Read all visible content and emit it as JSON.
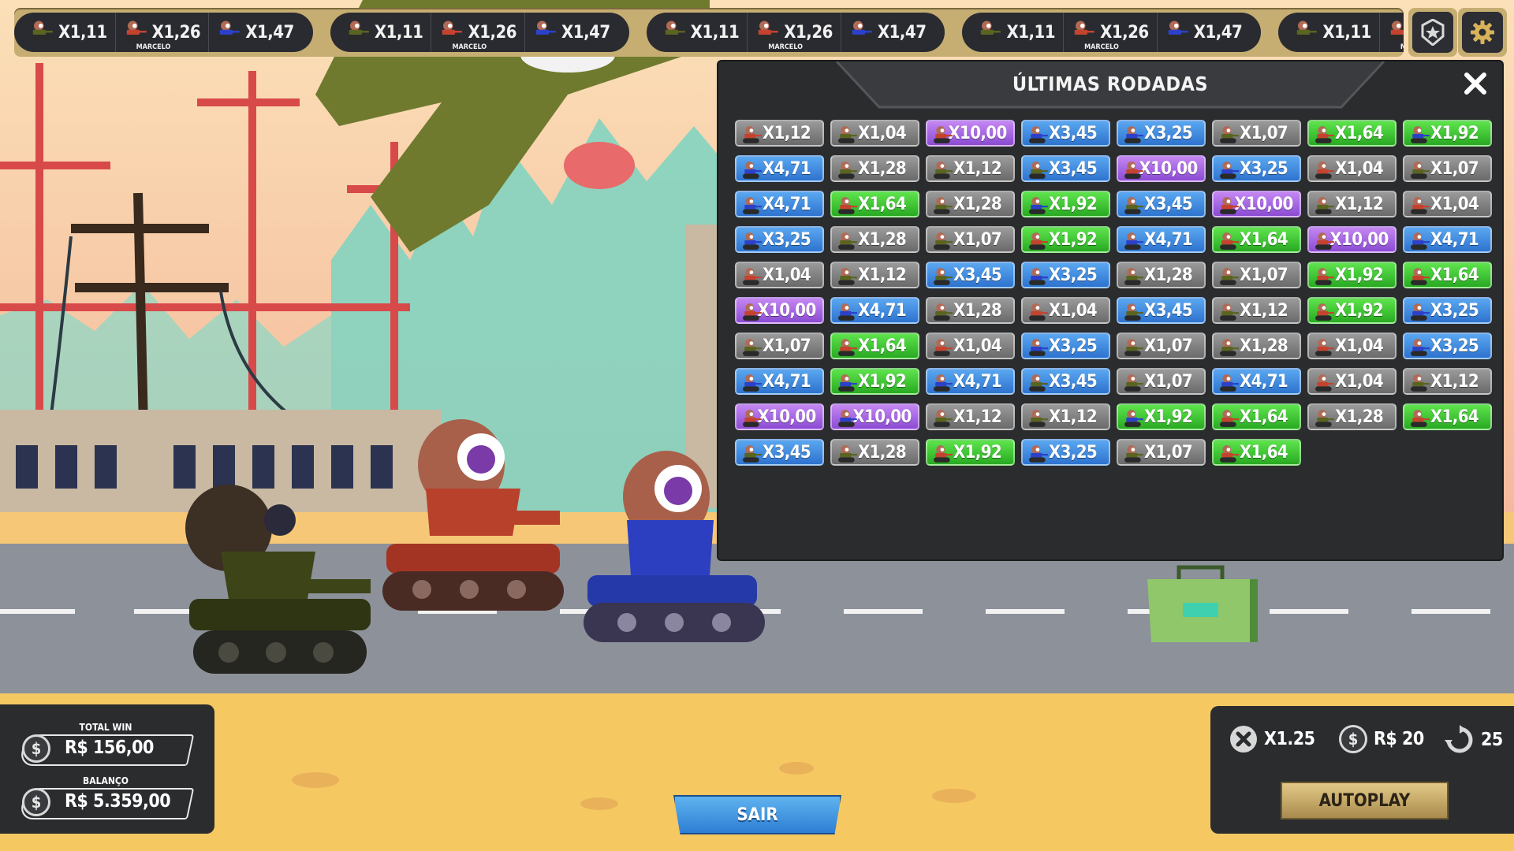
{
  "ticker": {
    "groups": [
      {
        "items": [
          {
            "value": "X1,11",
            "tank": "olive",
            "name": ""
          },
          {
            "value": "X1,26",
            "tank": "red",
            "name": "MARCELO"
          },
          {
            "value": "X1,47",
            "tank": "blue",
            "name": ""
          }
        ]
      },
      {
        "items": [
          {
            "value": "X1,11",
            "tank": "olive",
            "name": ""
          },
          {
            "value": "X1,26",
            "tank": "red",
            "name": "MARCELO"
          },
          {
            "value": "X1,47",
            "tank": "blue",
            "name": ""
          }
        ]
      },
      {
        "items": [
          {
            "value": "X1,11",
            "tank": "olive",
            "name": ""
          },
          {
            "value": "X1,26",
            "tank": "red",
            "name": "MARCELO"
          },
          {
            "value": "X1,47",
            "tank": "blue",
            "name": ""
          }
        ]
      },
      {
        "items": [
          {
            "value": "X1,11",
            "tank": "olive",
            "name": ""
          },
          {
            "value": "X1,26",
            "tank": "red",
            "name": "MARCELO"
          },
          {
            "value": "X1,47",
            "tank": "blue",
            "name": ""
          }
        ]
      },
      {
        "items": [
          {
            "value": "X1,11",
            "tank": "olive",
            "name": ""
          },
          {
            "value": "X1,26",
            "tank": "red",
            "name": "MARCELO"
          },
          {
            "value": "X1,47",
            "tank": "blue",
            "name": ""
          }
        ]
      },
      {
        "items": [
          {
            "value": "X1,",
            "tank": "olive",
            "name": ""
          }
        ]
      }
    ],
    "buttons": {
      "achievements_icon": "star-badge-icon",
      "settings_icon": "gear-icon"
    }
  },
  "panel": {
    "title": "ÚLTIMAS RODADAS",
    "close_icon": "close-icon",
    "results": [
      {
        "value": "X1,12",
        "color": "gray",
        "tank": "red"
      },
      {
        "value": "X1,04",
        "color": "gray",
        "tank": "olive"
      },
      {
        "value": "X10,00",
        "color": "purple",
        "tank": "red"
      },
      {
        "value": "X3,45",
        "color": "blue",
        "tank": "blue"
      },
      {
        "value": "X3,25",
        "color": "blue",
        "tank": "blue"
      },
      {
        "value": "X1,07",
        "color": "gray",
        "tank": "olive"
      },
      {
        "value": "X1,64",
        "color": "green",
        "tank": "red"
      },
      {
        "value": "X1,92",
        "color": "green",
        "tank": "blue"
      },
      {
        "value": "X4,71",
        "color": "blue",
        "tank": "blue"
      },
      {
        "value": "X1,28",
        "color": "gray",
        "tank": "olive"
      },
      {
        "value": "X1,12",
        "color": "gray",
        "tank": "olive"
      },
      {
        "value": "X3,45",
        "color": "blue",
        "tank": "olive"
      },
      {
        "value": "X10,00",
        "color": "purple",
        "tank": "red"
      },
      {
        "value": "X3,25",
        "color": "blue",
        "tank": "blue"
      },
      {
        "value": "X1,04",
        "color": "gray",
        "tank": "red"
      },
      {
        "value": "X1,07",
        "color": "gray",
        "tank": "olive"
      },
      {
        "value": "X4,71",
        "color": "blue",
        "tank": "blue"
      },
      {
        "value": "X1,64",
        "color": "green",
        "tank": "red"
      },
      {
        "value": "X1,28",
        "color": "gray",
        "tank": "olive"
      },
      {
        "value": "X1,92",
        "color": "green",
        "tank": "blue"
      },
      {
        "value": "X3,45",
        "color": "blue",
        "tank": "olive"
      },
      {
        "value": "X10,00",
        "color": "purple",
        "tank": "red"
      },
      {
        "value": "X1,12",
        "color": "gray",
        "tank": "olive"
      },
      {
        "value": "X1,04",
        "color": "gray",
        "tank": "red"
      },
      {
        "value": "X3,25",
        "color": "blue",
        "tank": "blue"
      },
      {
        "value": "X1,28",
        "color": "gray",
        "tank": "olive"
      },
      {
        "value": "X1,07",
        "color": "gray",
        "tank": "olive"
      },
      {
        "value": "X1,92",
        "color": "green",
        "tank": "red"
      },
      {
        "value": "X4,71",
        "color": "blue",
        "tank": "blue"
      },
      {
        "value": "X1,64",
        "color": "green",
        "tank": "red"
      },
      {
        "value": "X10,00",
        "color": "purple",
        "tank": "red"
      },
      {
        "value": "X4,71",
        "color": "blue",
        "tank": "blue"
      },
      {
        "value": "X1,04",
        "color": "gray",
        "tank": "red"
      },
      {
        "value": "X1,12",
        "color": "gray",
        "tank": "olive"
      },
      {
        "value": "X3,45",
        "color": "blue",
        "tank": "olive"
      },
      {
        "value": "X3,25",
        "color": "blue",
        "tank": "blue"
      },
      {
        "value": "X1,28",
        "color": "gray",
        "tank": "olive"
      },
      {
        "value": "X1,07",
        "color": "gray",
        "tank": "olive"
      },
      {
        "value": "X1,92",
        "color": "green",
        "tank": "red"
      },
      {
        "value": "X1,64",
        "color": "green",
        "tank": "red"
      },
      {
        "value": "X10,00",
        "color": "purple",
        "tank": "red"
      },
      {
        "value": "X4,71",
        "color": "blue",
        "tank": "blue"
      },
      {
        "value": "X1,28",
        "color": "gray",
        "tank": "olive"
      },
      {
        "value": "X1,04",
        "color": "gray",
        "tank": "red"
      },
      {
        "value": "X3,45",
        "color": "blue",
        "tank": "olive"
      },
      {
        "value": "X1,12",
        "color": "gray",
        "tank": "olive"
      },
      {
        "value": "X1,92",
        "color": "green",
        "tank": "red"
      },
      {
        "value": "X3,25",
        "color": "blue",
        "tank": "blue"
      },
      {
        "value": "X1,07",
        "color": "gray",
        "tank": "olive"
      },
      {
        "value": "X1,64",
        "color": "green",
        "tank": "red"
      },
      {
        "value": "X1,04",
        "color": "gray",
        "tank": "red"
      },
      {
        "value": "X3,25",
        "color": "blue",
        "tank": "blue"
      },
      {
        "value": "X1,07",
        "color": "gray",
        "tank": "olive"
      },
      {
        "value": "X1,28",
        "color": "gray",
        "tank": "olive"
      },
      {
        "value": "X1,04",
        "color": "gray",
        "tank": "red"
      },
      {
        "value": "X3,25",
        "color": "blue",
        "tank": "blue"
      },
      {
        "value": "X4,71",
        "color": "blue",
        "tank": "blue"
      },
      {
        "value": "X1,92",
        "color": "green",
        "tank": "blue"
      },
      {
        "value": "X4,71",
        "color": "blue",
        "tank": "blue"
      },
      {
        "value": "X3,45",
        "color": "blue",
        "tank": "olive"
      },
      {
        "value": "X1,07",
        "color": "gray",
        "tank": "olive"
      },
      {
        "value": "X4,71",
        "color": "blue",
        "tank": "blue"
      },
      {
        "value": "X1,04",
        "color": "gray",
        "tank": "red"
      },
      {
        "value": "X1,12",
        "color": "gray",
        "tank": "olive"
      },
      {
        "value": "X10,00",
        "color": "purple",
        "tank": "red"
      },
      {
        "value": "X10,00",
        "color": "purple",
        "tank": "blue"
      },
      {
        "value": "X1,12",
        "color": "gray",
        "tank": "olive"
      },
      {
        "value": "X1,12",
        "color": "gray",
        "tank": "olive"
      },
      {
        "value": "X1,92",
        "color": "green",
        "tank": "blue"
      },
      {
        "value": "X1,64",
        "color": "green",
        "tank": "red"
      },
      {
        "value": "X1,28",
        "color": "gray",
        "tank": "olive"
      },
      {
        "value": "X1,64",
        "color": "green",
        "tank": "red"
      },
      {
        "value": "X3,45",
        "color": "blue",
        "tank": "olive"
      },
      {
        "value": "X1,28",
        "color": "gray",
        "tank": "olive"
      },
      {
        "value": "X1,92",
        "color": "green",
        "tank": "red"
      },
      {
        "value": "X3,25",
        "color": "blue",
        "tank": "blue"
      },
      {
        "value": "X1,07",
        "color": "gray",
        "tank": "olive"
      },
      {
        "value": "X1,64",
        "color": "green",
        "tank": "red"
      }
    ]
  },
  "balance": {
    "total_win_label": "TOTAL WIN",
    "total_win_value": "R$ 156,00",
    "balance_label": "BALANÇO",
    "balance_value": "R$ 5.359,00",
    "coin_icon": "$"
  },
  "sair_label": "SAIR",
  "autoplay": {
    "multiplier": "X1.25",
    "bet": "R$ 20",
    "rounds": "25",
    "button_label": "AUTOPLAY"
  },
  "colors": {
    "chip_gray": "#7d7d7d",
    "chip_blue": "#3b8ae0",
    "chip_green": "#3fcf35",
    "chip_purple": "#a566e3",
    "tank_red": "#c4432f",
    "tank_blue": "#2c41c8",
    "tank_olive": "#5a6420",
    "panel_bg": "#2b2c2e",
    "gold": "#c6ad72"
  }
}
